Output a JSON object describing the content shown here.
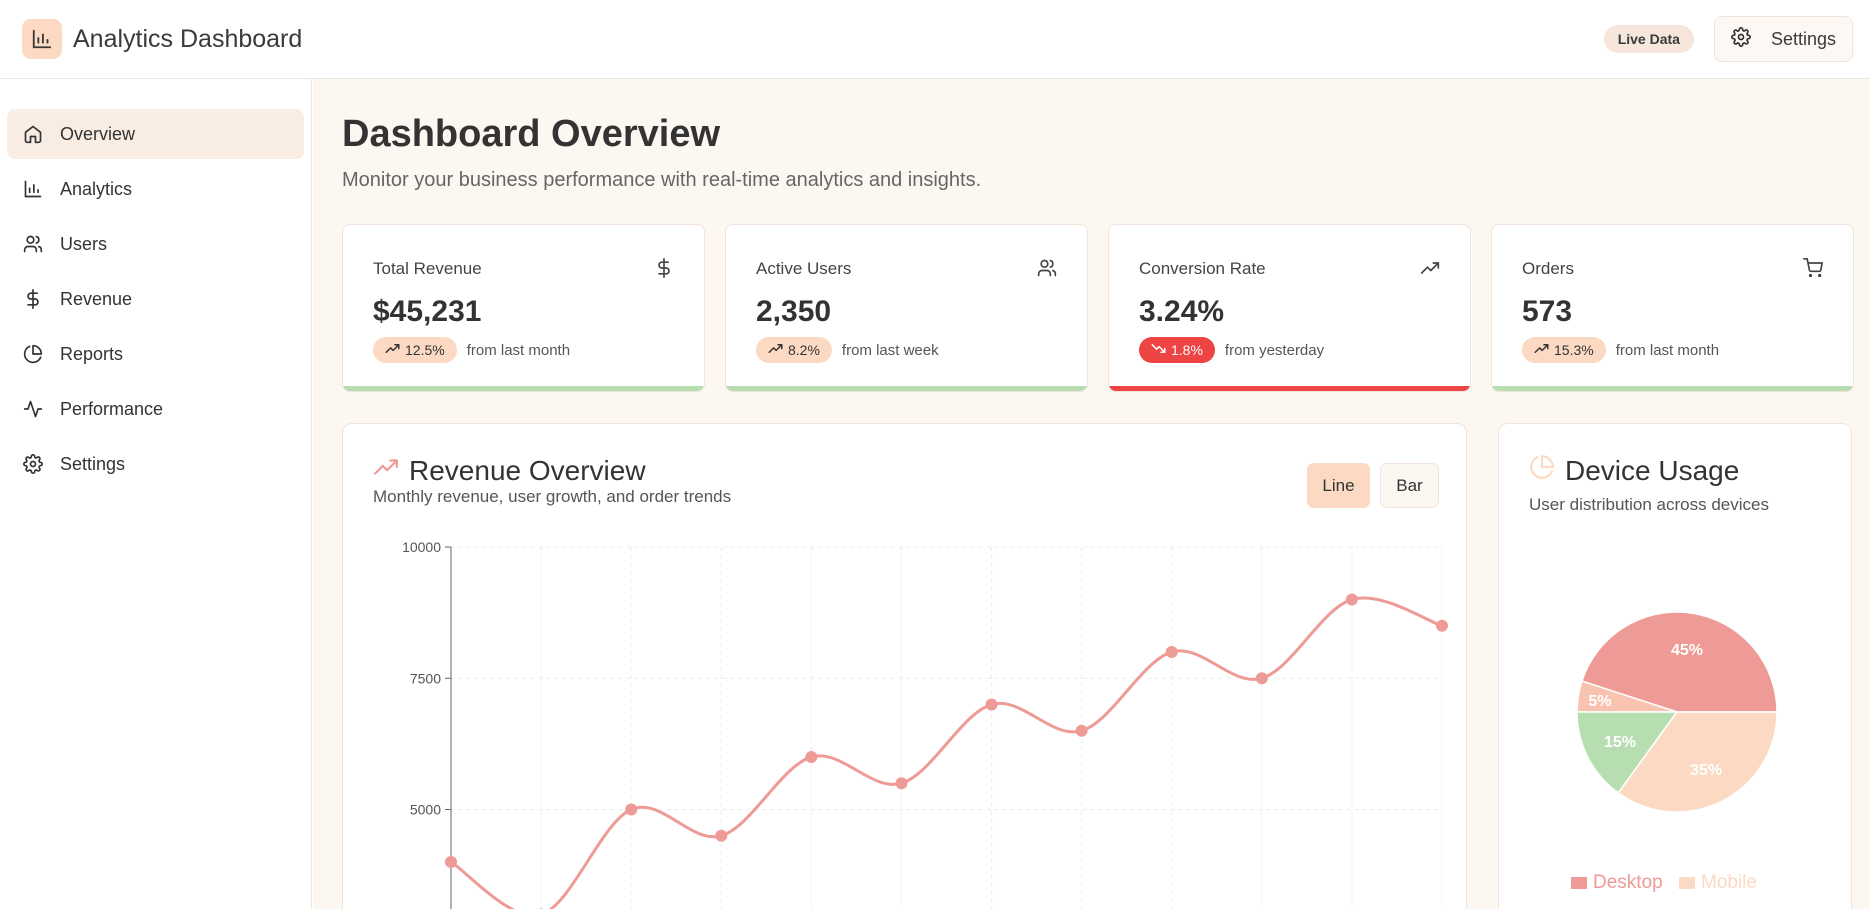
{
  "app": {
    "title": "Analytics Dashboard"
  },
  "header": {
    "live_badge": "Live Data",
    "settings_label": "Settings"
  },
  "sidebar": {
    "items": [
      {
        "label": "Overview",
        "icon": "home-icon",
        "active": true
      },
      {
        "label": "Analytics",
        "icon": "bar-chart-icon"
      },
      {
        "label": "Users",
        "icon": "users-icon"
      },
      {
        "label": "Revenue",
        "icon": "dollar-icon"
      },
      {
        "label": "Reports",
        "icon": "pie-chart-icon"
      },
      {
        "label": "Performance",
        "icon": "activity-icon"
      },
      {
        "label": "Settings",
        "icon": "gear-icon"
      }
    ]
  },
  "page": {
    "title": "Dashboard Overview",
    "subtitle": "Monitor your business performance with real-time analytics and insights."
  },
  "cards": [
    {
      "label": "Total Revenue",
      "icon": "dollar-icon",
      "value": "$45,231",
      "delta": "12.5%",
      "trend": "up",
      "period": "from last month"
    },
    {
      "label": "Active Users",
      "icon": "users-icon",
      "value": "2,350",
      "delta": "8.2%",
      "trend": "up",
      "period": "from last week"
    },
    {
      "label": "Conversion Rate",
      "icon": "trending-up-icon",
      "value": "3.24%",
      "delta": "1.8%",
      "trend": "down",
      "period": "from yesterday"
    },
    {
      "label": "Orders",
      "icon": "cart-icon",
      "value": "573",
      "delta": "15.3%",
      "trend": "up",
      "period": "from last month"
    }
  ],
  "revenue": {
    "title": "Revenue Overview",
    "subtitle": "Monthly revenue, user growth, and order trends",
    "toggle_line": "Line",
    "toggle_bar": "Bar"
  },
  "device": {
    "title": "Device Usage",
    "subtitle": "User distribution across devices",
    "legend": [
      {
        "label": "Desktop",
        "color": "#ee9a96"
      },
      {
        "label": "Mobile",
        "color": "#fcd9c2"
      }
    ]
  },
  "colors": {
    "accent": "#ee9a96",
    "peach": "#fcd9c2",
    "green": "#b6deb1",
    "red": "#ee4444"
  },
  "chart_data": [
    {
      "type": "line",
      "title": "Revenue Overview",
      "x": [
        "",
        "",
        "",
        "",
        "",
        "",
        "",
        "",
        "",
        "",
        "",
        ""
      ],
      "series": [
        {
          "values": [
            4000,
            3000,
            5000,
            4500,
            6000,
            5500,
            7000,
            6500,
            8000,
            7500,
            9000,
            8500
          ]
        }
      ],
      "ylim": [
        0,
        10000
      ],
      "yticks": [
        2500,
        5000,
        7500,
        10000
      ],
      "grid": true
    },
    {
      "type": "pie",
      "title": "Device Usage",
      "slices": [
        {
          "label": "45%",
          "value": 45,
          "color": "#ee9a96"
        },
        {
          "label": "5%",
          "value": 5,
          "color": "#f8c4b0"
        },
        {
          "label": "15%",
          "value": 15,
          "color": "#b6deb1"
        },
        {
          "label": "35%",
          "value": 35,
          "color": "#fcd9c2"
        }
      ]
    }
  ]
}
